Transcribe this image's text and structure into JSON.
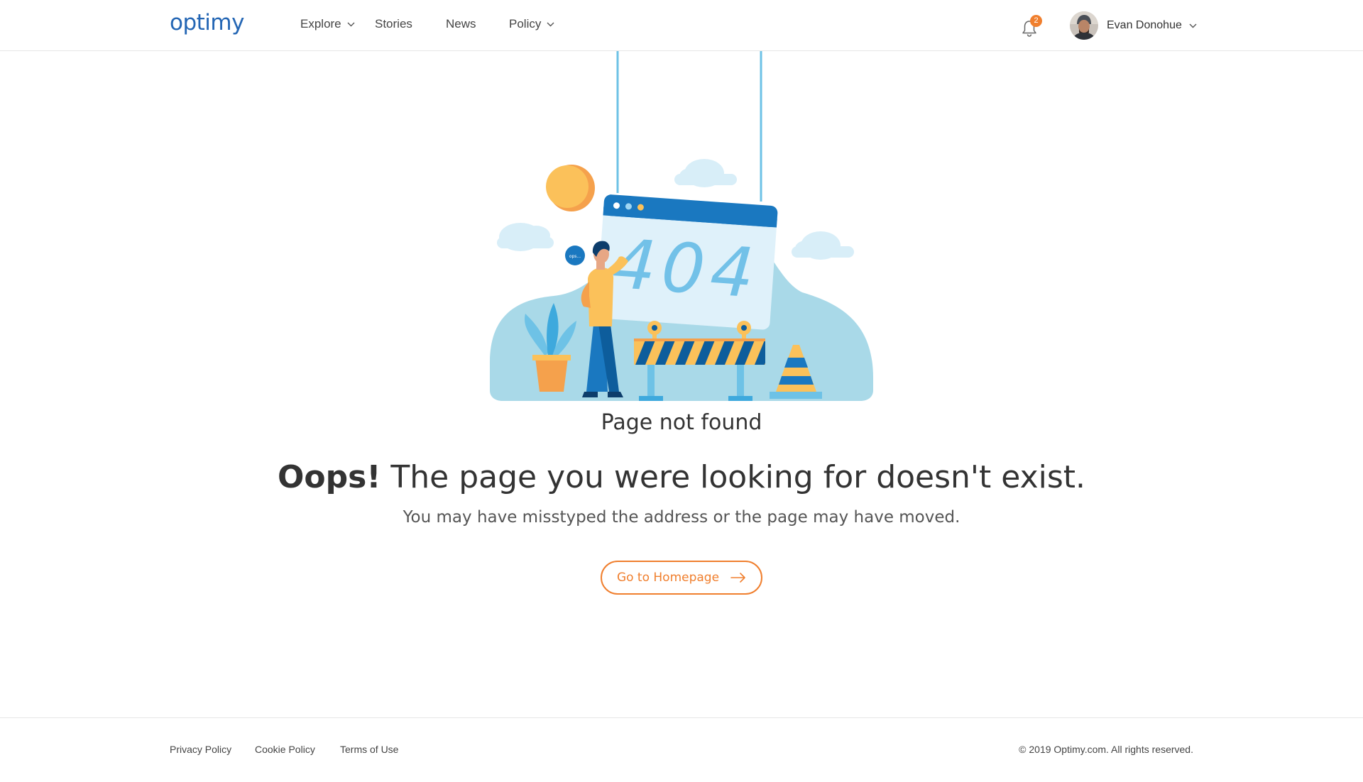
{
  "header": {
    "logo_text": "optimy",
    "nav": [
      {
        "label": "Explore",
        "has_dropdown": true
      },
      {
        "label": "Stories",
        "has_dropdown": false
      },
      {
        "label": "News",
        "has_dropdown": false
      },
      {
        "label": "Policy",
        "has_dropdown": true
      }
    ],
    "notifications_count": "2",
    "user_name": "Evan Donohue"
  },
  "illustration": {
    "window_text": "404",
    "speech_text": "ops..."
  },
  "main": {
    "page_not_found": "Page not found",
    "headline_bold": "Oops!",
    "headline_rest": " The page you were looking for doesn't exist.",
    "subline": "You may have misstyped the address or the page may have moved.",
    "button_label": "Go to Homepage"
  },
  "footer": {
    "links": [
      "Privacy Policy",
      "Cookie Policy",
      "Terms of Use"
    ],
    "copyright": "© 2019 Optimy.com. All rights reserved."
  },
  "colors": {
    "brand_blue": "#2466b4",
    "accent_orange": "#f07f2e"
  }
}
